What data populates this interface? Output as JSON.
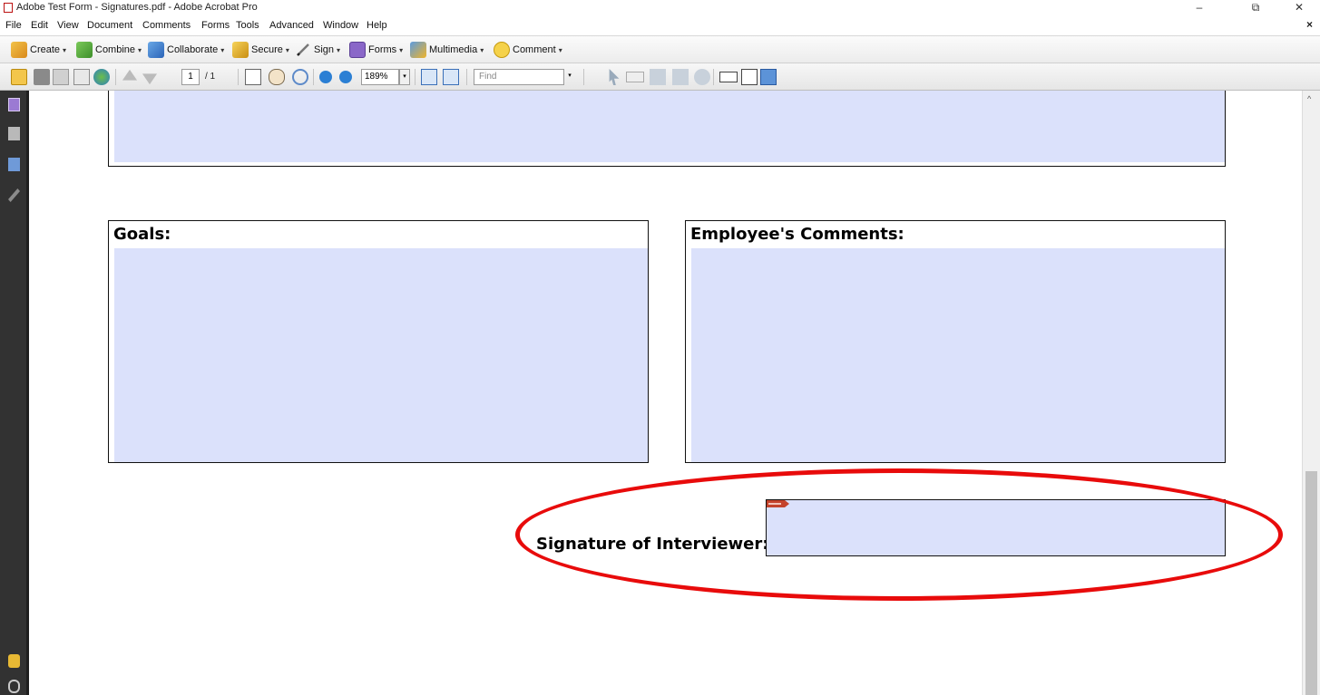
{
  "window": {
    "title": "Adobe Test Form - Signatures.pdf - Adobe Acrobat Pro",
    "minimize_glyph": "–",
    "restore_glyph": "⧉",
    "close_glyph": "✕"
  },
  "menubar": {
    "items": [
      "File",
      "Edit",
      "View",
      "Document",
      "Comments",
      "Forms",
      "Tools",
      "Advanced",
      "Window",
      "Help"
    ],
    "doc_close_glyph": "×"
  },
  "task_toolbar": {
    "items": [
      {
        "label": "Create",
        "icon": "create-pdf-icon"
      },
      {
        "label": "Combine",
        "icon": "combine-files-icon"
      },
      {
        "label": "Collaborate",
        "icon": "collaborate-icon"
      },
      {
        "label": "Secure",
        "icon": "padlock-icon"
      },
      {
        "label": "Sign",
        "icon": "pen-icon"
      },
      {
        "label": "Forms",
        "icon": "form-icon"
      },
      {
        "label": "Multimedia",
        "icon": "film-icon"
      },
      {
        "label": "Comment",
        "icon": "speech-bubble-icon"
      }
    ],
    "caret": "▾"
  },
  "quick_toolbar": {
    "page_number": "1",
    "page_total": "/ 1",
    "zoom": "189%",
    "find_placeholder": "Find"
  },
  "document": {
    "goals_label": "Goals:",
    "comments_label": "Employee's Comments:",
    "signature_label": "Signature of Interviewer:"
  },
  "colors": {
    "field_fill": "#dbe1fb",
    "annotation": "#e80b0b",
    "nav_panel": "#323232"
  }
}
